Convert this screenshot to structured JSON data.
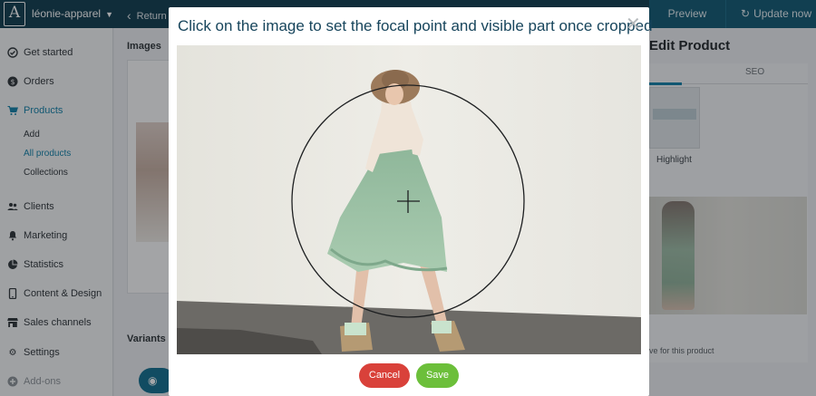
{
  "topbar": {
    "logo_letter": "A",
    "store_name": "léonie-apparel",
    "return_label": "Return",
    "preview_label": "Preview",
    "update_label": "Update now"
  },
  "sidebar": {
    "items": [
      {
        "label": "Get started",
        "icon": "check-circle-icon"
      },
      {
        "label": "Orders",
        "icon": "dollar-circle-icon"
      },
      {
        "label": "Products",
        "icon": "cart-icon",
        "active": true
      },
      {
        "label": "Clients",
        "icon": "people-icon"
      },
      {
        "label": "Marketing",
        "icon": "bell-icon"
      },
      {
        "label": "Statistics",
        "icon": "pie-chart-icon"
      },
      {
        "label": "Content & Design",
        "icon": "phone-icon"
      },
      {
        "label": "Sales channels",
        "icon": "store-icon"
      },
      {
        "label": "Settings",
        "icon": "gear-icon"
      },
      {
        "label": "Add-ons",
        "icon": "plus-circle-icon"
      }
    ],
    "sub_items": [
      {
        "label": "Add"
      },
      {
        "label": "All products",
        "active": true
      },
      {
        "label": "Collections"
      }
    ]
  },
  "main": {
    "images_label": "Images",
    "variants_label": "Variants",
    "edit_title": "Edit Product",
    "tab_seo": "SEO",
    "highlight_label": "Highlight",
    "product_note": "ve for this product"
  },
  "modal": {
    "title": "Click on the image to set the focal point and visible part once cropped",
    "close_glyph": "✕",
    "cancel_label": "Cancel",
    "save_label": "Save"
  },
  "colors": {
    "topbar": "#0e3b4d",
    "accent": "#0f7fa6",
    "cancel": "#d9413a",
    "save": "#6cbf3a",
    "title": "#17455c"
  }
}
